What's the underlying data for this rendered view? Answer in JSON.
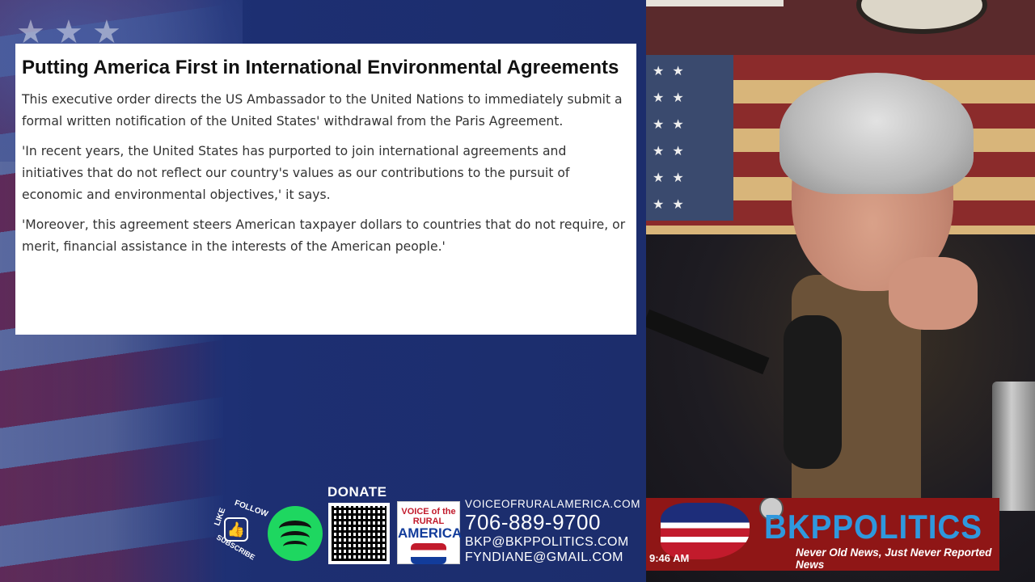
{
  "article": {
    "title": "Putting America First in International Environmental Agreements",
    "paragraphs": [
      " This executive order directs the US Ambassador to the United Nations to immediately submit a formal written notification of the United States' withdrawal from the Paris Agreement.",
      "'In recent years, the United States has purported to join international agreements and initiatives that do not reflect our country's values as our contributions to the pursuit of economic and environmental objectives,' it says.",
      "'Moreover, this agreement steers American taxpayer dollars to countries that do not require, or merit, financial assistance in the interests of the American people.'"
    ]
  },
  "footer": {
    "social": {
      "like": "LIKE",
      "follow": "FOLLOW",
      "subscribe": "SUBSCRIBE",
      "icon": "thumbs-up-icon"
    },
    "spotify_icon": "spotify-icon",
    "donate_label": "DONATE",
    "logo": {
      "line1": "VOICE of the RURAL",
      "line2": "AMERICA"
    },
    "contact": {
      "website": "VOICEOFRURALAMERICA.COM",
      "phone": "706-889-9700",
      "email1": "BKP@BKPPOLITICS.COM",
      "email2": "FYNDIANE@GMAIL.COM"
    }
  },
  "banner": {
    "logo": "BKPPOLITICS",
    "tagline": "Never Old News, Just Never Reported News",
    "time": "9:46 AM"
  },
  "colors": {
    "left_bg": "#1c2d6c",
    "banner_bg": "#8f1616",
    "banner_logo": "#2f98dd",
    "spotify": "#1ed760"
  }
}
